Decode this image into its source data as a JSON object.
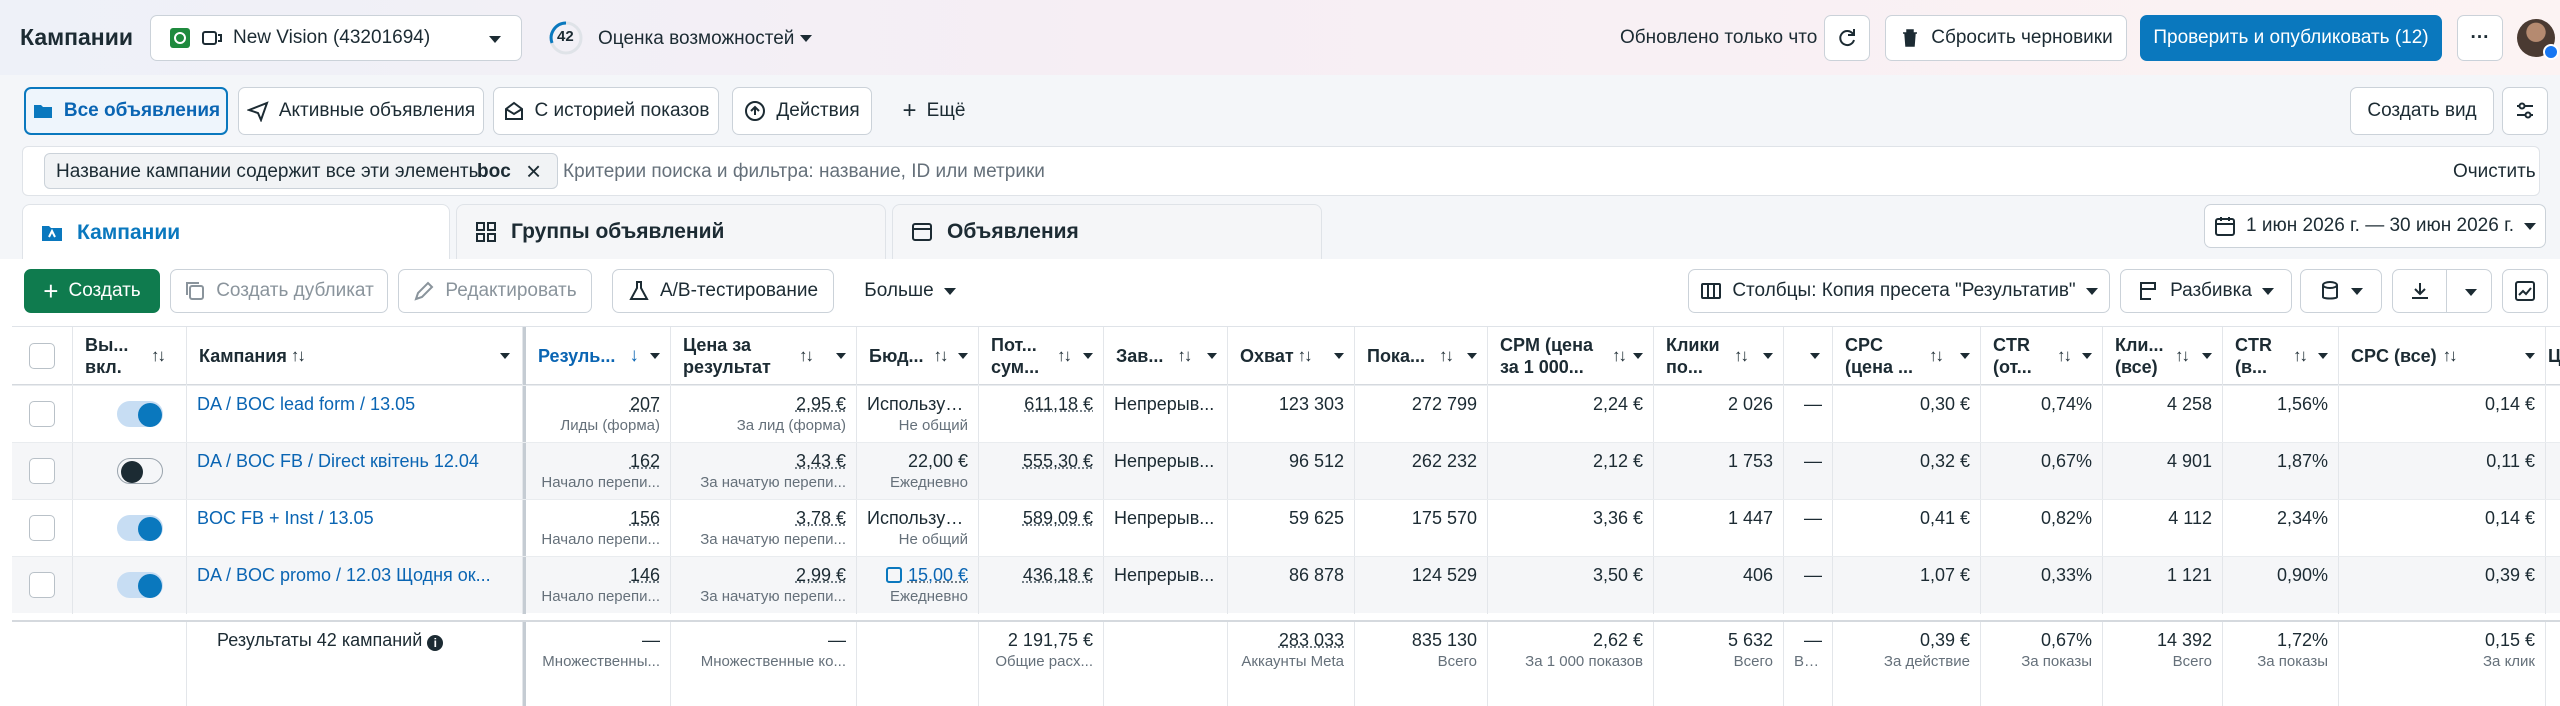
{
  "header": {
    "title": "Кампании",
    "account": "New Vision (43201694)",
    "score": "42",
    "opportunity": "Оценка возможностей",
    "updated": "Обновлено только что",
    "discard": "Сбросить черновики",
    "publish": "Проверить и опубликовать (12)",
    "more": "···"
  },
  "views": {
    "all": "Все объявления",
    "active": "Активные объявления",
    "history": "С историей показов",
    "actions": "Действия",
    "more": "Ещё",
    "create_view": "Создать вид"
  },
  "filter": {
    "chip_label": "Название кампании содержит все эти элементы:",
    "chip_value": "boc",
    "placeholder": "Критерии поиска и фильтра: название, ID или метрики",
    "clear": "Очистить"
  },
  "tabs": {
    "campaigns": "Кампании",
    "adsets": "Группы объявлений",
    "ads": "Объявления"
  },
  "date_range": "1 июн 2026 г. — 30 июн 2026 г.",
  "toolbar": {
    "create": "Создать",
    "duplicate": "Создать дубликат",
    "edit": "Редактировать",
    "ab": "A/B-тестирование",
    "more": "Больше",
    "columns": "Столбцы: Копия пресета \"Результатив\"",
    "breakdown": "Разбивка"
  },
  "columns": [
    "Вы... вкл.",
    "Кампания",
    "Резуль...",
    "Цена за результат",
    "Бюд...",
    "Пот... сум...",
    "Зав...",
    "Охват",
    "Пока...",
    "CPM (цена за 1 000...",
    "Клики по...",
    "",
    "CPC (цена ...",
    "CTR (от...",
    "Кли... (все)",
    "CTR (в...",
    "CPC (все)",
    "Ц"
  ],
  "rows": [
    {
      "on": true,
      "name": "DA / BOC lead form / 13.05",
      "results": "207",
      "results_sub": "Лиды (форма)",
      "cpr": "2,95 €",
      "cpr_sub": "За лид (форма)",
      "budget": "Использує...",
      "budget_sub": "Не общий",
      "spent": "611,18 €",
      "delivery": "Непрерыв...",
      "reach": "123 303",
      "impr": "272 799",
      "cpm": "2,24 €",
      "clicks": "2 026",
      "dash": "—",
      "cpc": "0,30 €",
      "ctr": "0,74%",
      "clicks_all": "4 258",
      "ctr_all": "1,56%",
      "cpc_all": "0,14 €"
    },
    {
      "on": false,
      "name": "DA / BOC FB / Direct квітень 12.04",
      "results": "162",
      "results_sub": "Начало перепи...",
      "cpr": "3,43 €",
      "cpr_sub": "За начатую перепи...",
      "budget": "22,00 €",
      "budget_sub": "Ежедневно",
      "spent": "555,30 €",
      "delivery": "Непрерыв...",
      "reach": "96 512",
      "impr": "262 232",
      "cpm": "2,12 €",
      "clicks": "1 753",
      "dash": "—",
      "cpc": "0,32 €",
      "ctr": "0,67%",
      "clicks_all": "4 901",
      "ctr_all": "1,87%",
      "cpc_all": "0,11 €"
    },
    {
      "on": true,
      "name": "BOC FB + Inst / 13.05",
      "results": "156",
      "results_sub": "Начало перепи...",
      "cpr": "3,78 €",
      "cpr_sub": "За начатую перепи...",
      "budget": "Использує...",
      "budget_sub": "Не общий",
      "spent": "589,09 €",
      "delivery": "Непрерыв...",
      "reach": "59 625",
      "impr": "175 570",
      "cpm": "3,36 €",
      "clicks": "1 447",
      "dash": "—",
      "cpc": "0,41 €",
      "ctr": "0,82%",
      "clicks_all": "4 112",
      "ctr_all": "2,34%",
      "cpc_all": "0,14 €"
    },
    {
      "on": true,
      "name": "DA / BOC promo / 12.03 Щодня ок...",
      "results": "146",
      "results_sub": "Начало перепи...",
      "cpr": "2,99 €",
      "cpr_sub": "За начатую перепи...",
      "budget": "15,00 €",
      "budget_sub": "Ежедневно",
      "spent": "436,18 €",
      "delivery": "Непрерыв...",
      "reach": "86 878",
      "impr": "124 529",
      "cpm": "3,50 €",
      "clicks": "406",
      "dash": "—",
      "cpc": "1,07 €",
      "ctr": "0,33%",
      "clicks_all": "1 121",
      "ctr_all": "0,90%",
      "cpc_all": "0,39 €"
    }
  ],
  "totals": {
    "label": "Результаты 42 кампаний",
    "results": "—",
    "results_sub": "Множественны...",
    "cpr": "—",
    "cpr_sub": "Множественные ко...",
    "spent": "2 191,75 €",
    "spent_sub": "Общие расх...",
    "reach": "283 033",
    "reach_sub": "Аккаунты Meta",
    "impr": "835 130",
    "impr_sub": "Всего",
    "cpm": "2,62 €",
    "cpm_sub": "За 1 000 показов",
    "clicks": "5 632",
    "clicks_sub": "Всего",
    "dash": "—",
    "dash_sub": "Вс...",
    "cpc": "0,39 €",
    "cpc_sub": "За действие",
    "ctr": "0,67%",
    "ctr_sub": "За показы",
    "clicks_all": "14 392",
    "clicks_all_sub": "Всего",
    "ctr_all": "1,72%",
    "ctr_all_sub": "За показы",
    "cpc_all": "0,15 €",
    "cpc_all_sub": "За клик"
  },
  "colors": {
    "accent": "#0a78be",
    "green": "#0f7b4e",
    "text": "#1c2b33"
  }
}
